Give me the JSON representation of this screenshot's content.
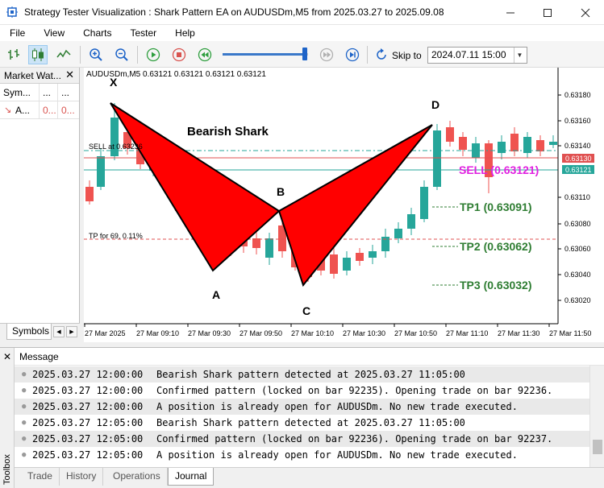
{
  "window": {
    "title": "Strategy Tester Visualization : Shark Pattern EA on AUDUSDm,M5 from 2025.03.27 to 2025.09.08"
  },
  "menu": [
    "File",
    "View",
    "Charts",
    "Tester",
    "Help"
  ],
  "toolbar": {
    "skip_label": "Skip to",
    "skip_date": "2024.07.11 15:00",
    "speed_fraction": 0.95
  },
  "market_watch": {
    "title": "Market Wat...",
    "header": [
      "Sym...",
      "...",
      "..."
    ],
    "row": [
      "A...",
      "0...",
      "0..."
    ],
    "tab": "Symbols"
  },
  "chart": {
    "info": "AUDUSDm,M5  0.63121 0.63121 0.63121 0.63121",
    "pattern_title": "Bearish Shark",
    "points": {
      "X": "X",
      "A": "A",
      "B": "B",
      "C": "C",
      "D": "D"
    },
    "sell_line_label": "SELL at 0.63236",
    "tp_line_label": "TP for 69, 0.11%",
    "sell_text": "SELL (0.63121)",
    "tp1": "TP1 (0.63091)",
    "tp2": "TP2 (0.63062)",
    "tp3": "TP3 (0.63032)",
    "price_ticks": [
      "0.63180",
      "0.63160",
      "0.63140",
      "0.63110",
      "0.63100",
      "0.63080",
      "0.63060",
      "0.63040",
      "0.63020"
    ],
    "price_tags": [
      "0.63130",
      "0.63121"
    ],
    "time_ticks": [
      "27 Mar 2025",
      "27 Mar 09:10",
      "27 Mar 09:30",
      "27 Mar 09:50",
      "27 Mar 10:10",
      "27 Mar 10:30",
      "27 Mar 10:50",
      "27 Mar 11:10",
      "27 Mar 11:30",
      "27 Mar 11:50"
    ],
    "colors": {
      "bull": "#26a69a",
      "bear": "#ef5350",
      "pattern_fill": "#ff0000",
      "sell_text": "#e020e0",
      "tp_text": "#2e7d32",
      "tag_red": "#e05050",
      "tag_teal": "#26a69a"
    }
  },
  "journal": {
    "column": "Message",
    "rows": [
      {
        "time": "2025.03.27 12:00:00",
        "message": "Bearish Shark pattern detected at 2025.03.27 11:05:00"
      },
      {
        "time": "2025.03.27 12:00:00",
        "message": "Confirmed pattern (locked on bar 92235). Opening trade on bar 92236."
      },
      {
        "time": "2025.03.27 12:00:00",
        "message": "A position is already open for AUDUSDm. No new trade executed."
      },
      {
        "time": "2025.03.27 12:05:00",
        "message": "Bearish Shark pattern detected at 2025.03.27 11:05:00"
      },
      {
        "time": "2025.03.27 12:05:00",
        "message": "Confirmed pattern (locked on bar 92236). Opening trade on bar 92237."
      },
      {
        "time": "2025.03.27 12:05:00",
        "message": "A position is already open for AUDUSDm. No new trade executed."
      }
    ],
    "side_label": "Toolbox",
    "tabs": [
      "Trade",
      "History",
      "Operations",
      "Journal"
    ],
    "active_tab": "Journal"
  }
}
